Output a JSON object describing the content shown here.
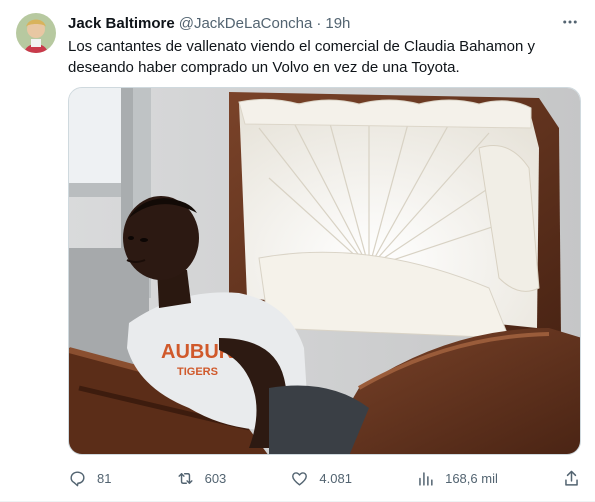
{
  "tweet": {
    "author": {
      "display_name": "Jack Baltimore",
      "handle": "@JackDeLaConcha",
      "time": "19h"
    },
    "separator": "·",
    "text": "Los cantantes de vallenato viendo el comercial de Claudia Bahamon y deseando haber comprado un Volvo en vez de una Toyota.",
    "media": {
      "shirt_text_1": "AUBURN",
      "shirt_text_2": "TIGERS"
    },
    "actions": {
      "replies": "81",
      "reposts": "603",
      "likes": "4.081",
      "views": "168,6 mil"
    }
  },
  "icons": {
    "more": "more-horizontal-icon",
    "reply": "reply-icon",
    "repost": "repost-icon",
    "like": "heart-icon",
    "views": "views-chart-icon",
    "share": "share-icon"
  },
  "colors": {
    "text_primary": "#0f1419",
    "text_secondary": "#536471",
    "border": "#cfd9de"
  }
}
